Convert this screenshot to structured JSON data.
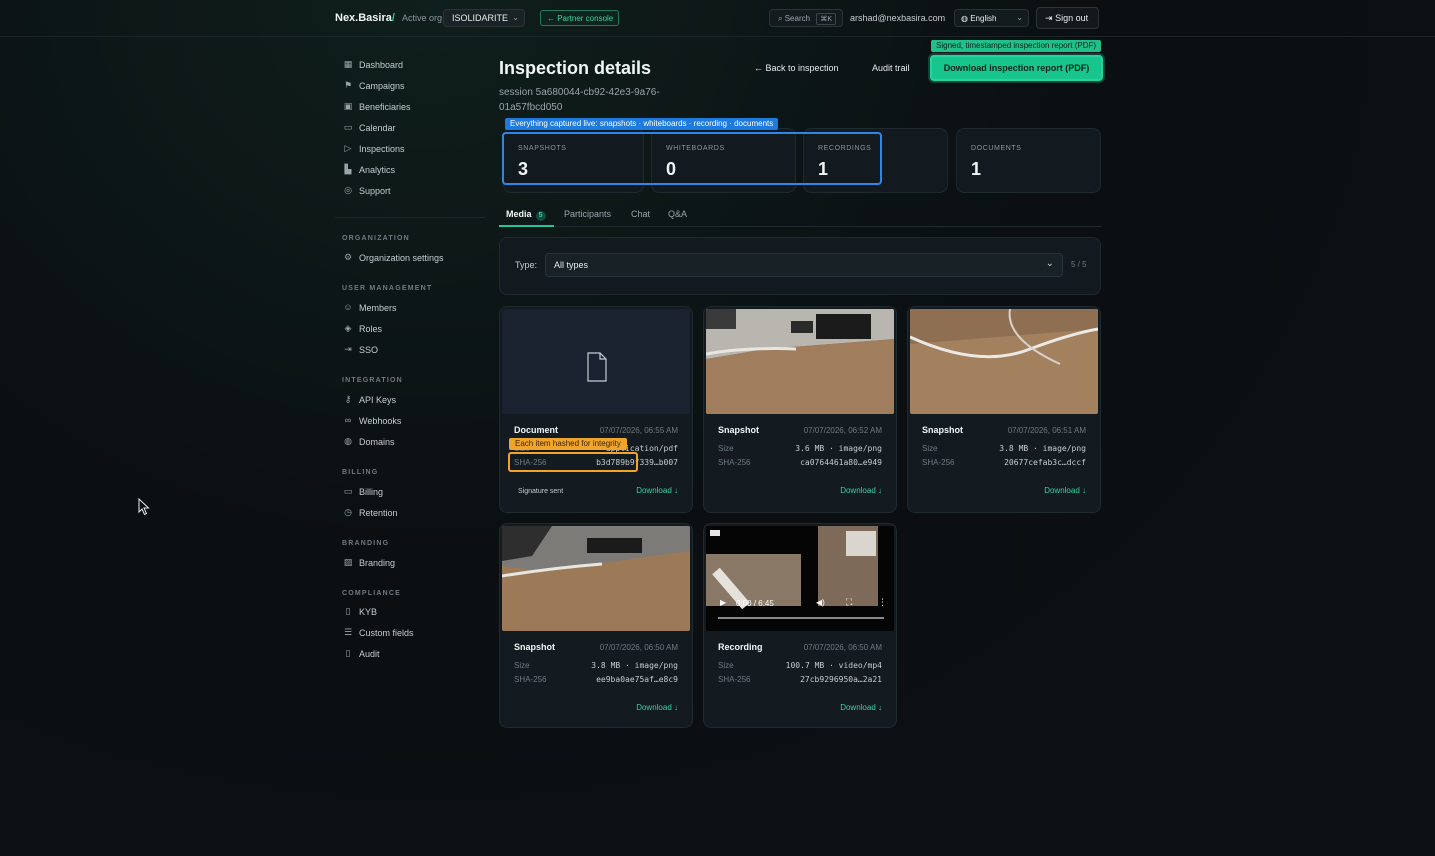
{
  "topbar": {
    "brand": "Nex.Basira",
    "brand_slash": "/",
    "active_org_label": "Active org",
    "org_value": "ISOLIDARITE",
    "partner_console": "← Partner console",
    "search_label": "Search",
    "search_kbd": "⌘K",
    "user_email": "arshad@nexbasira.com",
    "language": "English",
    "sign_out": "Sign out"
  },
  "sidebar": {
    "main_items": [
      {
        "label": "Dashboard",
        "icon": "dashboard-icon"
      },
      {
        "label": "Campaigns",
        "icon": "flag-icon"
      },
      {
        "label": "Beneficiaries",
        "icon": "beneficiaries-icon"
      },
      {
        "label": "Calendar",
        "icon": "calendar-icon"
      },
      {
        "label": "Inspections",
        "icon": "video-icon"
      },
      {
        "label": "Analytics",
        "icon": "chart-icon"
      },
      {
        "label": "Support",
        "icon": "support-icon"
      }
    ],
    "sections": {
      "organization": "ORGANIZATION",
      "user_management": "USER MANAGEMENT",
      "integration": "INTEGRATION",
      "billing": "BILLING",
      "branding": "BRANDING",
      "compliance": "COMPLIANCE"
    },
    "organization_settings": "Organization settings",
    "members": "Members",
    "roles": "Roles",
    "sso": "SSO",
    "api_keys": "API Keys",
    "webhooks": "Webhooks",
    "domains": "Domains",
    "billing": "Billing",
    "retention": "Retention",
    "branding": "Branding",
    "kyb": "KYB",
    "custom_fields": "Custom fields",
    "audit": "Audit"
  },
  "header": {
    "title": "Inspection details",
    "session": "session 5a680044-cb92-42e3-9a76-01a57fbcd050",
    "back": "← Back to inspection",
    "audit_trail": "Audit trail",
    "signed_tip": "Signed, timestamped inspection report (PDF)",
    "download_report": "Download inspection report (PDF)"
  },
  "stats": {
    "captured_tip": "Everything captured live: snapshots · whiteboards · recording · documents",
    "snapshots_label": "SNAPSHOTS",
    "snapshots_value": "3",
    "whiteboards_label": "WHITEBOARDS",
    "whiteboards_value": "0",
    "recordings_label": "RECORDINGS",
    "recordings_value": "1",
    "documents_label": "DOCUMENTS",
    "documents_value": "1"
  },
  "tabs": {
    "media": "Media",
    "media_count": "5",
    "participants": "Participants",
    "chat": "Chat",
    "qa": "Q&A"
  },
  "filter": {
    "type_label": "Type:",
    "type_value": "All types",
    "count": "5 / 5"
  },
  "cards": [
    {
      "title": "Document",
      "date": "07/07/2026, 06:55 AM",
      "size": "— · application/pdf",
      "hash": "b3d789b9f339…b007",
      "signature": "Signature sent",
      "download": "Download ↓"
    },
    {
      "title": "Snapshot",
      "date": "07/07/2026, 06:52 AM",
      "size": "3.6 MB · image/png",
      "hash": "ca0764461a80…e949",
      "download": "Download ↓"
    },
    {
      "title": "Snapshot",
      "date": "07/07/2026, 06:51 AM",
      "size": "3.8 MB · image/png",
      "hash": "20677cefab3c…dccf",
      "download": "Download ↓"
    },
    {
      "title": "Snapshot",
      "date": "07/07/2026, 06:50 AM",
      "size": "3.8 MB · image/png",
      "hash": "ee9ba0ae75af…e8c9",
      "download": "Download ↓"
    },
    {
      "title": "Recording",
      "date": "07/07/2026, 06:50 AM",
      "size": "100.7 MB · video/mp4",
      "hash": "27cb9296950a…2a21",
      "download": "Download ↓",
      "video_time": "0:00 / 6:45"
    }
  ],
  "labels": {
    "size": "Size",
    "sha": "SHA-256",
    "hash_tip": "Each item hashed for integrity"
  },
  "colors": {
    "accent": "#22c79a",
    "highlight_blue": "#2f86e8",
    "highlight_orange": "#f0a52a"
  }
}
